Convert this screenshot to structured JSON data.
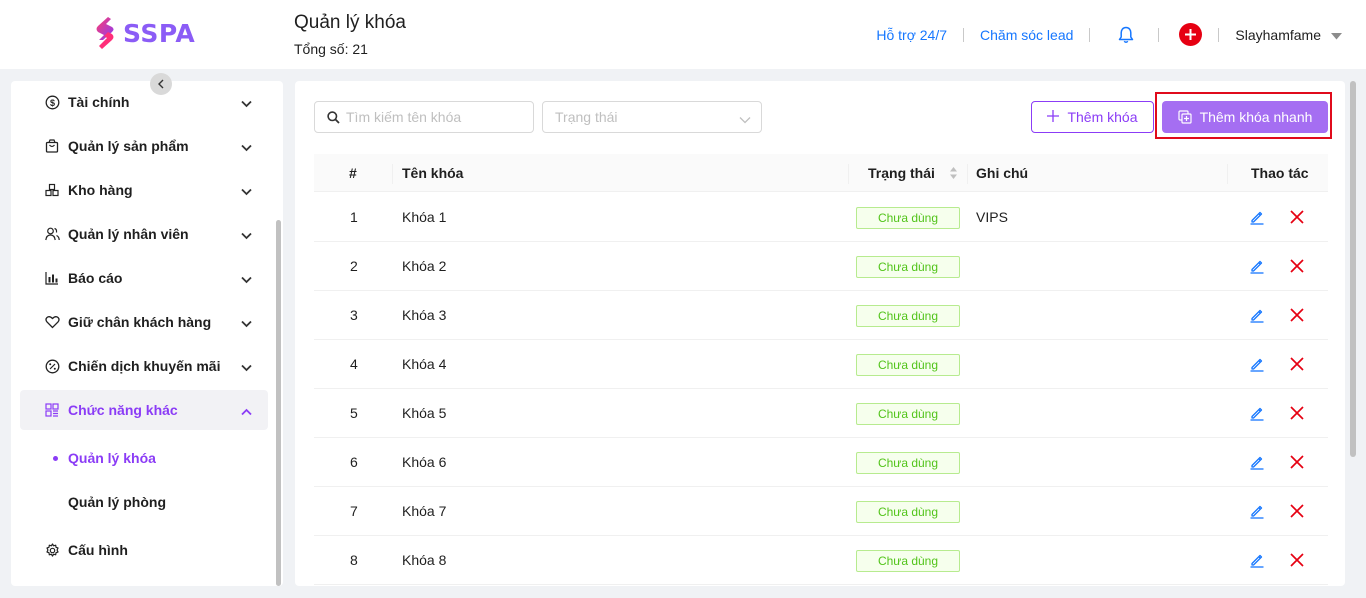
{
  "brand": {
    "name": "SSPA"
  },
  "header": {
    "title": "Quản lý khóa",
    "count_label": "Tổng số: 21",
    "support_link": "Hỗ trợ 24/7",
    "lead_link": "Chăm sóc lead",
    "user_name": "Slayhamfame"
  },
  "sidebar": {
    "items": [
      {
        "label": "Tài chính",
        "icon": "dollar-circle-icon"
      },
      {
        "label": "Quản lý sản phẩm",
        "icon": "shopping-bag-icon"
      },
      {
        "label": "Kho hàng",
        "icon": "boxes-icon"
      },
      {
        "label": "Quản lý nhân viên",
        "icon": "users-icon"
      },
      {
        "label": "Báo cáo",
        "icon": "bar-chart-icon"
      },
      {
        "label": "Giữ chân khách hàng",
        "icon": "heart-icon"
      },
      {
        "label": "Chiến dịch khuyến mãi",
        "icon": "discount-icon"
      },
      {
        "label": "Chức năng khác",
        "icon": "apps-icon"
      }
    ],
    "sub_items": [
      {
        "label": "Quản lý khóa"
      },
      {
        "label": "Quản lý phòng"
      }
    ],
    "config": {
      "label": "Cấu hình",
      "icon": "gear-icon"
    }
  },
  "toolbar": {
    "search_placeholder": "Tìm kiếm tên khóa",
    "status_placeholder": "Trạng thái",
    "add_label": "Thêm khóa",
    "quick_add_label": "Thêm khóa nhanh"
  },
  "table": {
    "columns": {
      "index": "#",
      "name": "Tên khóa",
      "status": "Trạng thái",
      "note": "Ghi chú",
      "actions": "Thao tác"
    },
    "rows": [
      {
        "index": "1",
        "name": "Khóa 1",
        "status": "Chưa dùng",
        "note": "VIPS"
      },
      {
        "index": "2",
        "name": "Khóa 2",
        "status": "Chưa dùng",
        "note": ""
      },
      {
        "index": "3",
        "name": "Khóa 3",
        "status": "Chưa dùng",
        "note": ""
      },
      {
        "index": "4",
        "name": "Khóa 4",
        "status": "Chưa dùng",
        "note": ""
      },
      {
        "index": "5",
        "name": "Khóa 5",
        "status": "Chưa dùng",
        "note": ""
      },
      {
        "index": "6",
        "name": "Khóa 6",
        "status": "Chưa dùng",
        "note": ""
      },
      {
        "index": "7",
        "name": "Khóa 7",
        "status": "Chưa dùng",
        "note": ""
      },
      {
        "index": "8",
        "name": "Khóa 8",
        "status": "Chưa dùng",
        "note": ""
      }
    ]
  },
  "colors": {
    "accent": "#8b3cf6",
    "link": "#1677ff",
    "danger": "#e60012",
    "success": "#52c41a"
  }
}
